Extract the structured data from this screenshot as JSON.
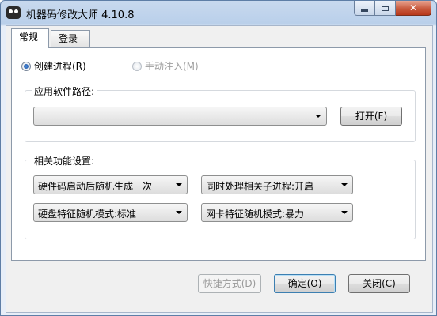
{
  "window": {
    "title": "机器码修改大师 4.10.8",
    "icon": "owl-face-icon"
  },
  "tabs": [
    {
      "label": "常规",
      "active": true
    },
    {
      "label": "登录",
      "active": false
    }
  ],
  "launch_mode": {
    "options": [
      {
        "label": "创建进程(R)",
        "checked": true,
        "enabled": true
      },
      {
        "label": "手动注入(M)",
        "checked": false,
        "enabled": false
      }
    ]
  },
  "app_path": {
    "group_title": "应用软件路径:",
    "value": "",
    "open_button": "打开(F)"
  },
  "settings": {
    "group_title": "相关功能设置:",
    "combos": [
      {
        "value": "硬件码启动后随机生成一次"
      },
      {
        "value": "同时处理相关子进程:开启"
      },
      {
        "value": "硬盘特征随机模式:标准"
      },
      {
        "value": "网卡特征随机模式:暴力"
      }
    ]
  },
  "footer": {
    "shortcut_button": "快捷方式(D)",
    "ok_button": "确定(O)",
    "close_button": "关闭(C)"
  },
  "colors": {
    "titlebar": "#b9cfea",
    "close_button": "#c85a3e",
    "default_button_border": "#3c7fb1"
  }
}
